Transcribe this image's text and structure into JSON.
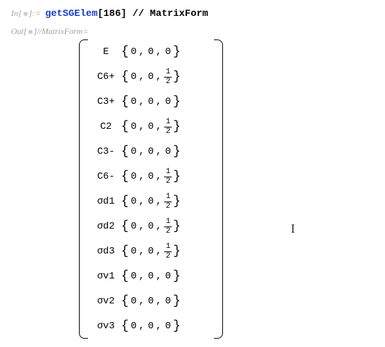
{
  "input": {
    "prefix": "In[",
    "suffix": "]:=",
    "fn": "getSGElem",
    "openBracket": "[",
    "arg": "186",
    "closeBracket": "]",
    "postfix": " // ",
    "pp": "MatrixForm"
  },
  "output": {
    "prefix": "Out[",
    "suffix": "]//MatrixForm="
  },
  "matrix": {
    "rows": [
      {
        "label": "E",
        "vec": [
          "0",
          "0",
          "0"
        ],
        "half": false
      },
      {
        "label": "C6+",
        "vec": [
          "0",
          "0",
          "1/2"
        ],
        "half": true
      },
      {
        "label": "C3+",
        "vec": [
          "0",
          "0",
          "0"
        ],
        "half": false
      },
      {
        "label": "C2",
        "vec": [
          "0",
          "0",
          "1/2"
        ],
        "half": true
      },
      {
        "label": "C3-",
        "vec": [
          "0",
          "0",
          "0"
        ],
        "half": false
      },
      {
        "label": "C6-",
        "vec": [
          "0",
          "0",
          "1/2"
        ],
        "half": true
      },
      {
        "label": "σd1",
        "vec": [
          "0",
          "0",
          "1/2"
        ],
        "half": true
      },
      {
        "label": "σd2",
        "vec": [
          "0",
          "0",
          "1/2"
        ],
        "half": true
      },
      {
        "label": "σd3",
        "vec": [
          "0",
          "0",
          "1/2"
        ],
        "half": true
      },
      {
        "label": "σv1",
        "vec": [
          "0",
          "0",
          "0"
        ],
        "half": false
      },
      {
        "label": "σv2",
        "vec": [
          "0",
          "0",
          "0"
        ],
        "half": false
      },
      {
        "label": "σv3",
        "vec": [
          "0",
          "0",
          "0"
        ],
        "half": false
      }
    ]
  },
  "cursor": "I"
}
